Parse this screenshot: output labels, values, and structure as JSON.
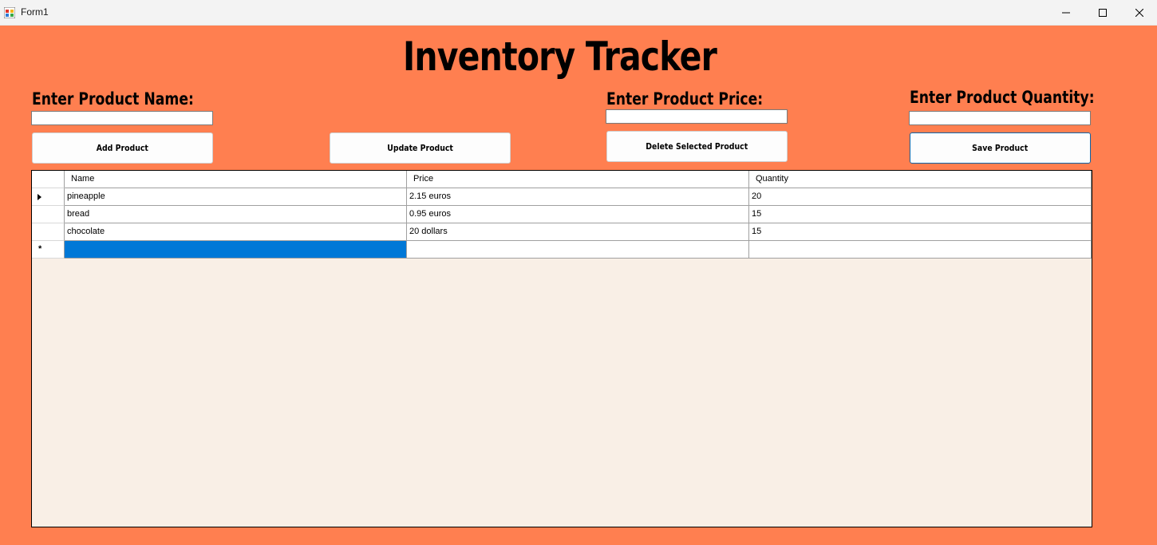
{
  "window": {
    "title": "Form1"
  },
  "header": {
    "title": "Inventory Tracker"
  },
  "form": {
    "name_label": "Enter Product Name:",
    "price_label": "Enter Product Price:",
    "quantity_label": "Enter Product Quantity:",
    "name_value": "",
    "price_value": "",
    "quantity_value": ""
  },
  "buttons": {
    "add": "Add Product",
    "update": "Update Product",
    "delete": "Delete Selected Product",
    "save": "Save Product"
  },
  "grid": {
    "columns": [
      "Name",
      "Price",
      "Quantity"
    ],
    "rows": [
      [
        "pineapple",
        "2.15 euros",
        "20"
      ],
      [
        "bread",
        "0.95 euros",
        "15"
      ],
      [
        "chocolate",
        "20 dollars",
        "15"
      ]
    ],
    "new_row_marker": "*",
    "selection_color": "#0078d7"
  },
  "colors": {
    "form_background": "#ff7f50",
    "grid_background": "#f9efe6"
  }
}
